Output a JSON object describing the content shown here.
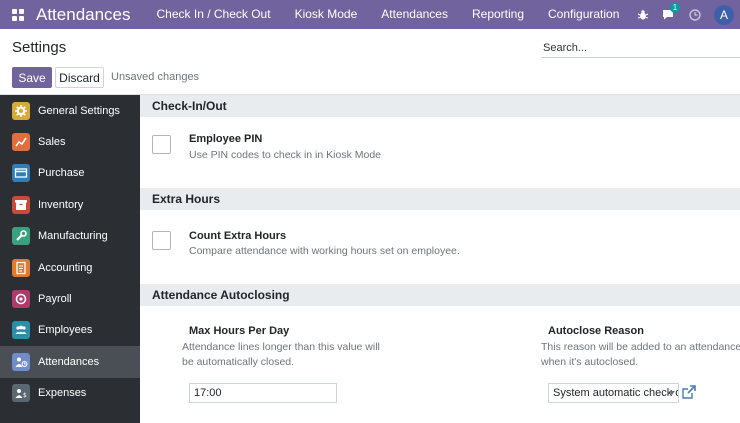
{
  "navbar": {
    "brand": "Attendances",
    "menu": [
      "Check In / Check Out",
      "Kiosk Mode",
      "Attendances",
      "Reporting",
      "Configuration"
    ],
    "messages_badge": "1",
    "user_initial": "A"
  },
  "control": {
    "breadcrumb": "Settings",
    "search_placeholder": "Search...",
    "save_label": "Save",
    "discard_label": "Discard",
    "status": "Unsaved changes"
  },
  "sidebar": {
    "items": [
      {
        "label": "General Settings",
        "icon": "gear-icon",
        "color": "#d8a93a"
      },
      {
        "label": "Sales",
        "icon": "chart-icon",
        "color": "#e06e3f"
      },
      {
        "label": "Purchase",
        "icon": "card-icon",
        "color": "#2d7fb9"
      },
      {
        "label": "Inventory",
        "icon": "box-icon",
        "color": "#c94a3a"
      },
      {
        "label": "Manufacturing",
        "icon": "wrench-icon",
        "color": "#3aa07e"
      },
      {
        "label": "Accounting",
        "icon": "document-icon",
        "color": "#e07a2f"
      },
      {
        "label": "Payroll",
        "icon": "coin-icon",
        "color": "#b03a6a"
      },
      {
        "label": "Employees",
        "icon": "people-icon",
        "color": "#2b8fa8"
      },
      {
        "label": "Attendances",
        "icon": "person-clock-icon",
        "color": "#6f8ec9"
      },
      {
        "label": "Expenses",
        "icon": "receipt-icon",
        "color": "#5a6670"
      }
    ],
    "active_index": 8
  },
  "main": {
    "sections": {
      "checkin": {
        "title": "Check-In/Out",
        "setting_title": "Employee PIN",
        "setting_desc": "Use PIN codes to check in in Kiosk Mode"
      },
      "extra": {
        "title": "Extra Hours",
        "setting_title": "Count Extra Hours",
        "setting_desc": "Compare attendance with working hours set on employee."
      },
      "autoclose": {
        "title": "Attendance Autoclosing",
        "max_hours_title": "Max Hours Per Day",
        "max_hours_desc_1": "Attendance lines longer than this value will",
        "max_hours_desc_2": "be automatically closed.",
        "max_hours_value": "17:00",
        "reason_title": "Autoclose Reason",
        "reason_desc_1": "This reason will be added to an attendance",
        "reason_desc_2": "when it's autoclosed.",
        "reason_value": "System automatic check out"
      }
    }
  },
  "colors": {
    "brand": "#71639e",
    "sidebar_bg": "#2b2f33",
    "section_bg": "#e9ecef"
  }
}
